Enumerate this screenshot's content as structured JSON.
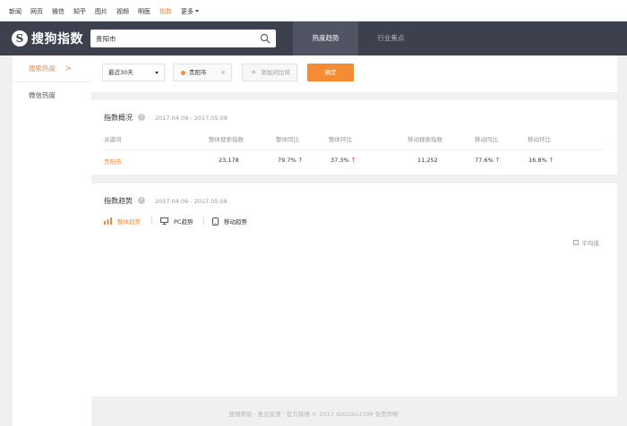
{
  "topnav": {
    "links": [
      "新闻",
      "网页",
      "微信",
      "知乎",
      "图片",
      "视频",
      "明医",
      "指数"
    ],
    "more": "更多",
    "active_index": 7
  },
  "header": {
    "logo_mark": "S",
    "logo_text": "搜狗指数",
    "search_value": "贵阳市",
    "tabs": [
      "热度趋势",
      "行业焦点"
    ]
  },
  "sidebar": {
    "items": [
      "搜索热度",
      "微信热度"
    ]
  },
  "filter": {
    "period": "最近30天",
    "keyword": "贵阳市",
    "remove": "×",
    "add_compare": "添加对比词",
    "add_plus": "+",
    "confirm": "确定"
  },
  "overview": {
    "title": "指数概况",
    "date_range": "2017.04.09 - 2017.05.08",
    "columns": [
      "关键词",
      "整体搜索指数",
      "整体同比",
      "整体环比",
      "移动搜索指数",
      "移动同比",
      "移动环比"
    ],
    "row": {
      "keyword": "贵阳市",
      "total_index": "23,178",
      "total_yoy": "79.7%",
      "total_mom": "37.3%",
      "mobile_index": "11,252",
      "mobile_yoy": "77.6%",
      "mobile_mom": "16.8%"
    },
    "up_arrow": "↑"
  },
  "trend": {
    "title": "指数趋势",
    "date_range": "2017.04.09 - 2017.05.08",
    "tabs": [
      "整体趋势",
      "PC趋势",
      "移动趋势"
    ],
    "average_label": "平均值"
  },
  "footer": "使用帮助 · 意见反馈 · 官方微博 © 2017 SOGOU.COM 免责声明",
  "colors": {
    "accent": "#f58b33",
    "header_bg": "#3d404d",
    "up_red": "#e6332a"
  }
}
